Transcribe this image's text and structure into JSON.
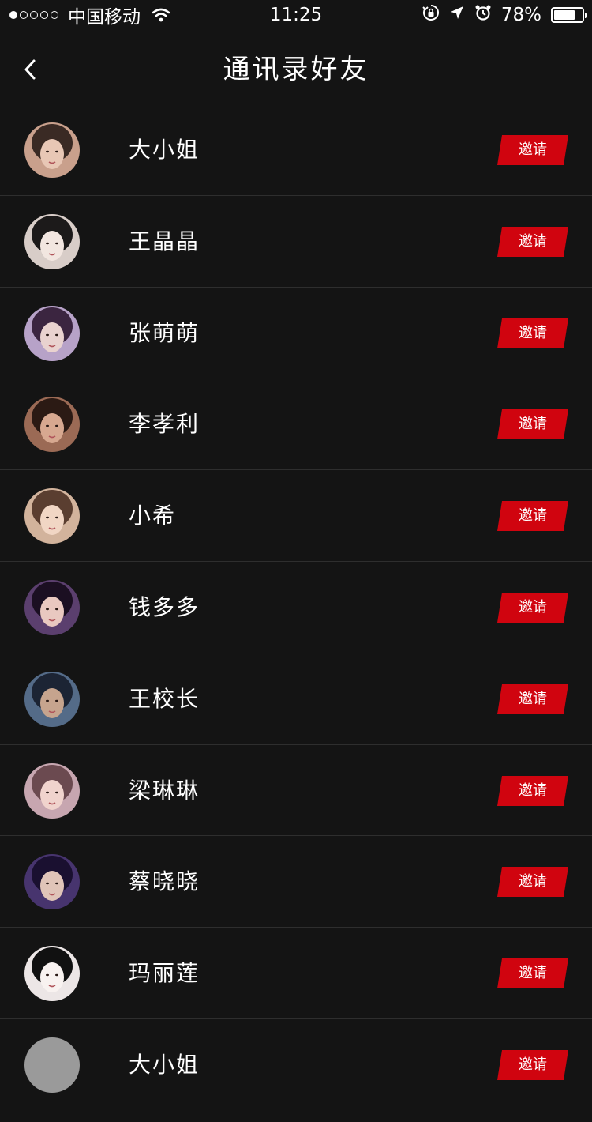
{
  "status_bar": {
    "carrier": "中国移动",
    "time": "11:25",
    "battery_percent": "78%",
    "battery_level": 0.78,
    "signal_bars_filled": 1,
    "signal_bars_total": 5
  },
  "nav": {
    "title": "通讯录好友",
    "back_icon": "chevron-left-icon"
  },
  "colors": {
    "background": "#141414",
    "divider": "#2e2e2e",
    "invite_accent": "#d0040f"
  },
  "contacts": [
    {
      "name": "大小姐",
      "invite_label": "邀请",
      "avatar": "photo"
    },
    {
      "name": "王晶晶",
      "invite_label": "邀请",
      "avatar": "photo"
    },
    {
      "name": "张萌萌",
      "invite_label": "邀请",
      "avatar": "photo"
    },
    {
      "name": "李孝利",
      "invite_label": "邀请",
      "avatar": "photo"
    },
    {
      "name": "小希",
      "invite_label": "邀请",
      "avatar": "photo"
    },
    {
      "name": "钱多多",
      "invite_label": "邀请",
      "avatar": "photo"
    },
    {
      "name": "王校长",
      "invite_label": "邀请",
      "avatar": "photo"
    },
    {
      "name": "梁琳琳",
      "invite_label": "邀请",
      "avatar": "photo"
    },
    {
      "name": "蔡晓晓",
      "invite_label": "邀请",
      "avatar": "photo"
    },
    {
      "name": "玛丽莲",
      "invite_label": "邀请",
      "avatar": "photo"
    },
    {
      "name": "大小姐",
      "invite_label": "邀请",
      "avatar": "placeholder"
    }
  ]
}
